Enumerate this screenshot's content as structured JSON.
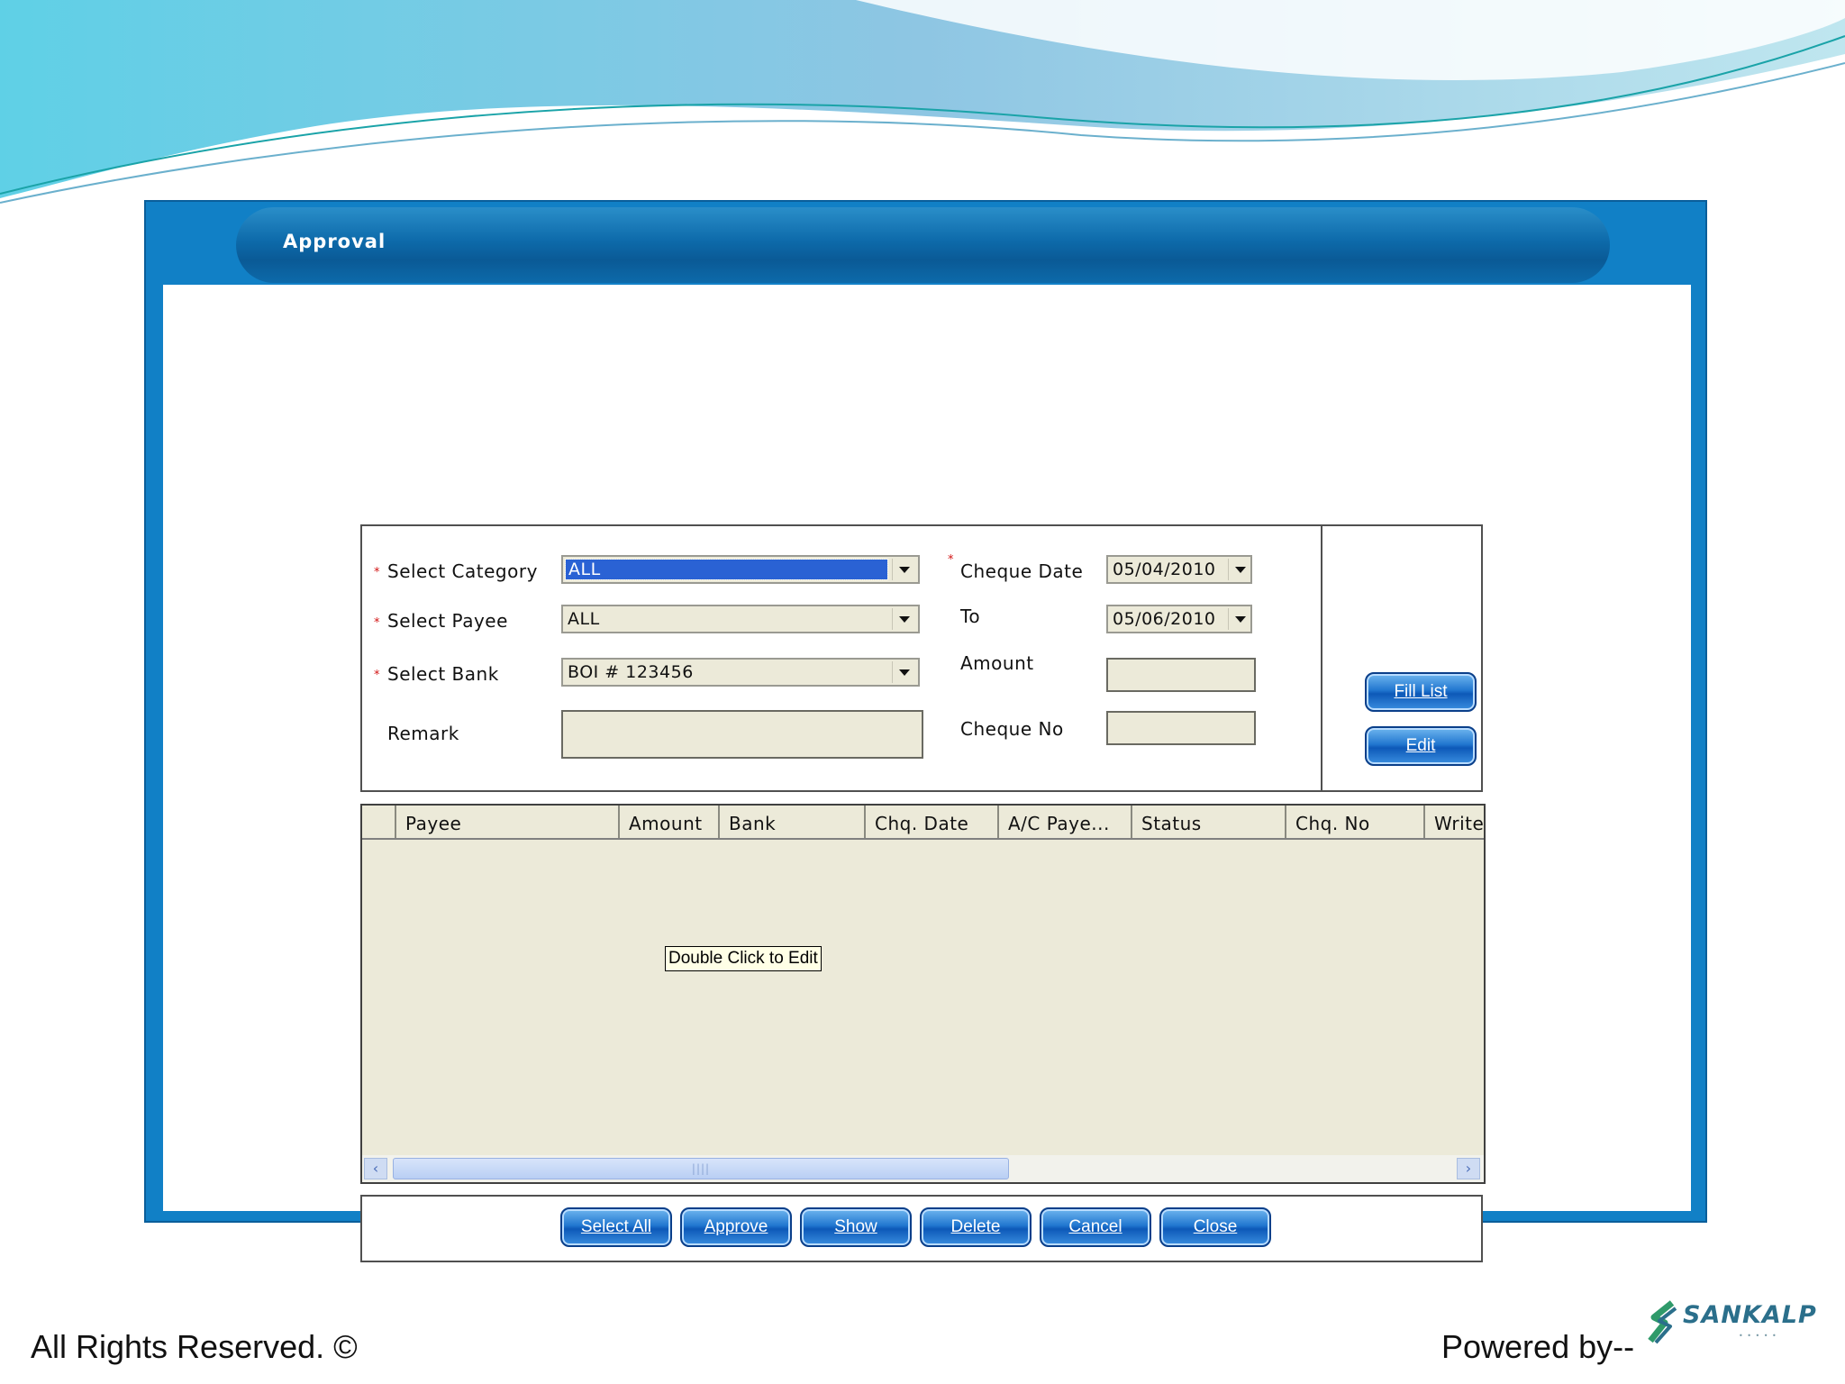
{
  "window": {
    "title": "Approval"
  },
  "form": {
    "category": {
      "label": "Select Category",
      "value": "ALL"
    },
    "payee": {
      "label": "Select Payee",
      "value": "ALL"
    },
    "bank": {
      "label": "Select Bank",
      "value": "BOI # 123456"
    },
    "remark": {
      "label": "Remark",
      "value": ""
    },
    "cheque_date": {
      "label": "Cheque Date",
      "value": "05/04/2010"
    },
    "to": {
      "label": "To",
      "value": "05/06/2010"
    },
    "amount": {
      "label": "Amount",
      "value": ""
    },
    "cheque_no": {
      "label": "Cheque No",
      "value": ""
    },
    "required_marker": "*"
  },
  "side_buttons": {
    "fill_list": "Fill List",
    "edit": "Edit"
  },
  "grid": {
    "columns": [
      "",
      "Payee",
      "Amount",
      "Bank",
      "Chq. Date",
      "A/C Paye...",
      "Status",
      "Chq. No",
      "Write"
    ],
    "tooltip": "Double Click to Edit"
  },
  "bottom_buttons": {
    "select_all": "Select All",
    "approve": "Approve",
    "show": "Show",
    "delete": "Delete",
    "cancel": "Cancel",
    "close": "Close"
  },
  "footer": {
    "rights": "All Rights Reserved. ©",
    "powered_by": "Powered by--",
    "logo_text": "SANKALP"
  },
  "colors": {
    "window_blue": "#1180c6",
    "form_bg": "#ecead9",
    "button_blue": "#2277d0",
    "selection": "#2a62d4"
  }
}
